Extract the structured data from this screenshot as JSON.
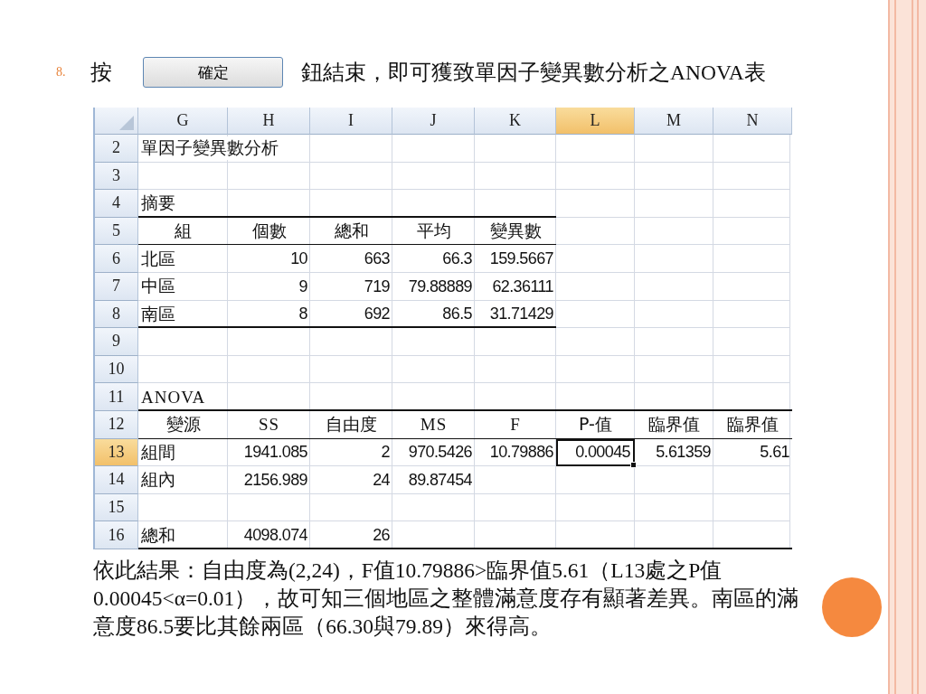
{
  "slide": {
    "step_number": "8.",
    "text_before": "按",
    "button_label": "確定",
    "text_after": "鈕結束，即可獲致單因子變異數分析之ANOVA表"
  },
  "spreadsheet": {
    "columns": [
      {
        "label": "G",
        "selected": false
      },
      {
        "label": "H",
        "selected": false
      },
      {
        "label": "I",
        "selected": false
      },
      {
        "label": "J",
        "selected": false
      },
      {
        "label": "K",
        "selected": false
      },
      {
        "label": "L",
        "selected": true
      },
      {
        "label": "M",
        "selected": false
      },
      {
        "label": "N",
        "selected": false
      }
    ],
    "rows": [
      {
        "number": "2",
        "selected": false,
        "cells": [
          {
            "text": "單因子變異數分析",
            "active": false
          },
          null,
          null,
          null,
          null,
          null,
          null,
          null
        ]
      },
      {
        "number": "3",
        "selected": false,
        "cells": [
          null,
          null,
          null,
          null,
          null,
          null,
          null,
          null
        ]
      },
      {
        "number": "4",
        "selected": false,
        "cells": [
          {
            "text": "摘要",
            "active": false
          },
          null,
          null,
          null,
          null,
          null,
          null,
          null
        ]
      },
      {
        "number": "5",
        "selected": false,
        "cells": [
          {
            "text": "組",
            "active": false
          },
          {
            "text": "個數",
            "active": false
          },
          {
            "text": "總和",
            "active": false
          },
          {
            "text": "平均",
            "active": false
          },
          {
            "text": "變異數",
            "active": false
          },
          null,
          null,
          null
        ]
      },
      {
        "number": "6",
        "selected": false,
        "cells": [
          {
            "text": "北區",
            "active": false
          },
          {
            "text": "10",
            "active": false
          },
          {
            "text": "663",
            "active": false
          },
          {
            "text": "66.3",
            "active": false
          },
          {
            "text": "159.5667",
            "active": false
          },
          null,
          null,
          null
        ]
      },
      {
        "number": "7",
        "selected": false,
        "cells": [
          {
            "text": "中區",
            "active": false
          },
          {
            "text": "9",
            "active": false
          },
          {
            "text": "719",
            "active": false
          },
          {
            "text": "79.88889",
            "active": false
          },
          {
            "text": "62.36111",
            "active": false
          },
          null,
          null,
          null
        ]
      },
      {
        "number": "8",
        "selected": false,
        "cells": [
          {
            "text": "南區",
            "active": false
          },
          {
            "text": "8",
            "active": false
          },
          {
            "text": "692",
            "active": false
          },
          {
            "text": "86.5",
            "active": false
          },
          {
            "text": "31.71429",
            "active": false
          },
          null,
          null,
          null
        ]
      },
      {
        "number": "9",
        "selected": false,
        "cells": [
          null,
          null,
          null,
          null,
          null,
          null,
          null,
          null
        ]
      },
      {
        "number": "10",
        "selected": false,
        "cells": [
          null,
          null,
          null,
          null,
          null,
          null,
          null,
          null
        ]
      },
      {
        "number": "11",
        "selected": false,
        "cells": [
          {
            "text": "ANOVA",
            "active": false
          },
          null,
          null,
          null,
          null,
          null,
          null,
          null
        ]
      },
      {
        "number": "12",
        "selected": false,
        "cells": [
          {
            "text": "變源",
            "active": false
          },
          {
            "text": "SS",
            "active": false
          },
          {
            "text": "自由度",
            "active": false
          },
          {
            "text": "MS",
            "active": false
          },
          {
            "text": "F",
            "active": false
          },
          {
            "text": "P-值",
            "active": false
          },
          {
            "text": "臨界值",
            "active": false
          },
          {
            "text": "臨界值",
            "active": false
          }
        ]
      },
      {
        "number": "13",
        "selected": true,
        "cells": [
          {
            "text": "組間",
            "active": false
          },
          {
            "text": "1941.085",
            "active": false
          },
          {
            "text": "2",
            "active": false
          },
          {
            "text": "970.5426",
            "active": false
          },
          {
            "text": "10.79886",
            "active": false
          },
          {
            "text": "0.00045",
            "active": true
          },
          {
            "text": "5.61359",
            "active": false
          },
          {
            "text": "5.61",
            "active": false
          }
        ]
      },
      {
        "number": "14",
        "selected": false,
        "cells": [
          {
            "text": "組內",
            "active": false
          },
          {
            "text": "2156.989",
            "active": false
          },
          {
            "text": "24",
            "active": false
          },
          {
            "text": "89.87454",
            "active": false
          },
          null,
          null,
          null,
          null
        ]
      },
      {
        "number": "15",
        "selected": false,
        "cells": [
          null,
          null,
          null,
          null,
          null,
          null,
          null,
          null
        ]
      },
      {
        "number": "16",
        "selected": false,
        "cells": [
          {
            "text": "總和",
            "active": false
          },
          {
            "text": "4098.074",
            "active": false
          },
          {
            "text": "26",
            "active": false
          },
          null,
          null,
          null,
          null,
          null
        ]
      }
    ]
  },
  "conclusion": "依此結果：自由度為(2,24)，F值10.79886>臨界值5.61（L13處之P值 0.00045<α=0.01），故可知三個地區之整體滿意度存有顯著差異。南區的滿意度86.5要比其餘兩區（66.30與79.89）來得高。"
}
